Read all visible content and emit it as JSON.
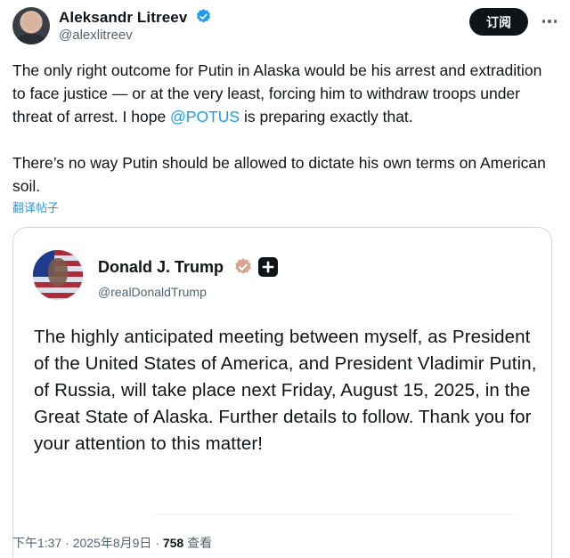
{
  "author": {
    "name": "Aleksandr Litreev",
    "handle": "@alexlitreev"
  },
  "subscribe_label": "订阅",
  "tweet": {
    "text_part1": "The only right outcome for Putin in Alaska would be his arrest and extradition to face justice — or at the very least, forcing him to withdraw troops under threat of arrest. I hope ",
    "mention": "@POTUS",
    "text_part2": " is preparing exactly that.\n\nThere’s no way Putin should be allowed to dictate his own terms on American soil."
  },
  "translate_label": "翻译帖子",
  "quote": {
    "name": "Donald J. Trump",
    "handle": "@realDonaldTrump",
    "text": "The highly anticipated meeting between myself, as President of the United States of America, and President Vladimir Putin, of Russia, will take place next Friday, August 15, 2025, in the Great State of Alaska. Further details to follow. Thank you for your attention to this matter!"
  },
  "meta": {
    "time": "下午1:37 · 2025年8月9日 · ",
    "views": "758",
    "views_label": " 查看"
  },
  "colors": {
    "accent": "#1d9bf0",
    "text": "#0f1419",
    "muted": "#536471",
    "gold_badge": "#d9a38f",
    "border": "#cfd9de"
  },
  "icons": {
    "verified": "verified-badge-icon",
    "gold": "gold-verified-badge-icon",
    "plus": "plus-icon",
    "more": "more-icon"
  }
}
